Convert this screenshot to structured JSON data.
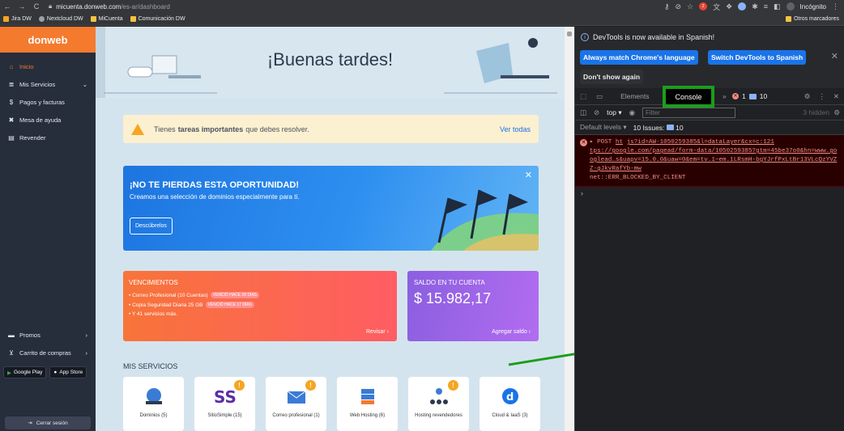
{
  "browser": {
    "url_host": "micuenta.donweb.com",
    "url_path": "/es-ar/dashboard",
    "profile_label": "Incógnito",
    "ext_badge": "2"
  },
  "bookmarks": {
    "items": [
      {
        "label": "Jira DW",
        "color": "#f5a623"
      },
      {
        "label": "Nextcloud DW",
        "color": "#9aa0a6"
      },
      {
        "label": "MiCuenta",
        "color": "#f5c342"
      },
      {
        "label": "Comunicación DW",
        "color": "#f5c342"
      }
    ],
    "other": "Otros marcadores"
  },
  "sidebar": {
    "logo": "donweb",
    "items": [
      {
        "label": "Inicio",
        "icon": "home-icon",
        "glyph": "⌂"
      },
      {
        "label": "Mis Servicios",
        "icon": "list-icon",
        "glyph": "≣"
      },
      {
        "label": "Pagos y facturas",
        "icon": "dollar-icon",
        "glyph": "$"
      },
      {
        "label": "Mesa de ayuda",
        "icon": "help-icon",
        "glyph": "✖"
      },
      {
        "label": "Revender",
        "icon": "card-icon",
        "glyph": "▤"
      }
    ],
    "promos": "Promos",
    "cart": "Carrito de compras",
    "google_play": "Google Play",
    "app_store": "App Store",
    "logout": "Cerrar sesión"
  },
  "main": {
    "greeting": "¡Buenas tardes!",
    "notice": {
      "pre": "Tienes",
      "bold": "tareas importantes",
      "post": "que debes resolver.",
      "link": "Ver todas"
    },
    "promo": {
      "title": "¡NO TE PIERDAS ESTA OPORTUNIDAD!",
      "subtitle": "Creamos una selección de dominios especialmente para tí.",
      "button": "Descúbrelos"
    },
    "vencimientos": {
      "title": "VENCIMIENTOS",
      "rows": [
        {
          "text": "• Correo Profesional (10 Cuentas)",
          "badge": "VENCIÓ HACE 28 DÍAS"
        },
        {
          "text": "• Copia Seguridad Diaria 25 GB",
          "badge": "VENCIÓ HACE 17 DÍAS"
        },
        {
          "text": "• Y 41 servicios más.",
          "badge": ""
        }
      ],
      "link": "Revisar ›"
    },
    "saldo": {
      "title": "SALDO EN TU CUENTA",
      "value": "$ 15.982,17",
      "link": "Agregar saldo ›"
    },
    "mis_servicios": "MIS SERVICIOS",
    "services": [
      {
        "label": "Dominios (5)",
        "alert": false
      },
      {
        "label": "SitioSimple (15)",
        "alert": true
      },
      {
        "label": "Correo profesional (1)",
        "alert": true
      },
      {
        "label": "Web Hosting (6)",
        "alert": false
      },
      {
        "label": "Hosting revendedores",
        "alert": true
      },
      {
        "label": "Cloud & IaaS (3)",
        "alert": false
      }
    ]
  },
  "devtools": {
    "info_msg": "DevTools is now available in Spanish!",
    "btn_match": "Always match Chrome's language",
    "btn_switch": "Switch DevTools to Spanish",
    "btn_dont": "Don't show again",
    "tab_elements": "Elements",
    "tab_console": "Console",
    "errors": "1",
    "messages": "10",
    "context": "top",
    "filter_placeholder": "Filter",
    "hidden": "3 hidden",
    "levels": "Default levels",
    "issues_label": "10 Issues:",
    "issues_count": "10",
    "error": {
      "method": "▸ POST",
      "link_a": "ht",
      "link_b": "js?id=AW-1050259385&l=dataLayer&cx=c:121",
      "url": "tps://google.com/pagead/form-data/1050259385?gtm=45be37o0&hn=www.googlead…s&uapv=15.0.0&uaw=0&em=tv.1~em.1LRsmH-bgYJrfPxLtBr13VLcQzYVZZ-gJkvRafYb-mw",
      "message": "net::ERR_BLOCKED_BY_CLIENT"
    },
    "prompt": "›"
  },
  "colors": {
    "accent": "#f47a2e",
    "devtools_blue": "#1a73e8",
    "highlight_green": "#1b9e1b"
  }
}
